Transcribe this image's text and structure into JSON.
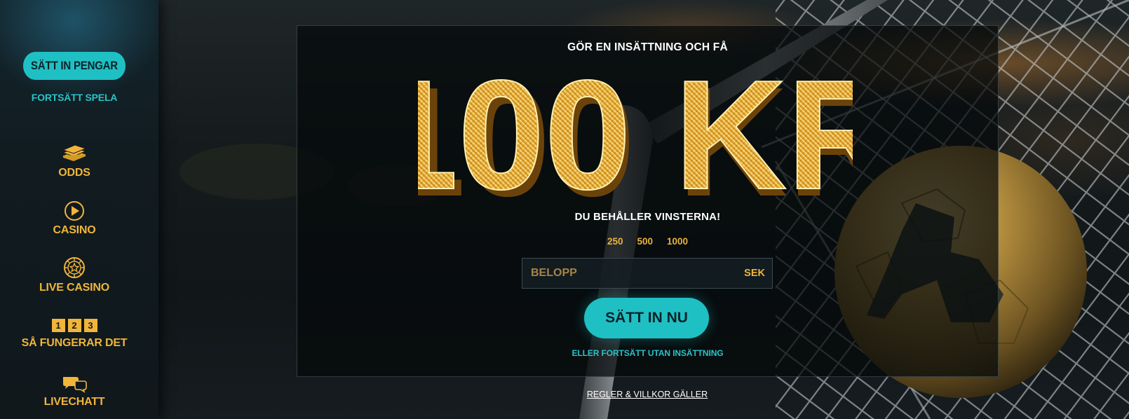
{
  "sidebar": {
    "deposit_button": "SÄTT IN PENGAR",
    "continue_link": "FORTSÄTT SPELA",
    "items": [
      {
        "label": "ODDS",
        "icon": "money-stack-icon"
      },
      {
        "label": "CASINO",
        "icon": "play-circle-icon"
      },
      {
        "label": "LIVE CASINO",
        "icon": "roulette-chip-icon"
      },
      {
        "label": "SÅ FUNGERAR DET",
        "icon": "steps-123-icon",
        "steps": [
          "1",
          "2",
          "3"
        ]
      },
      {
        "label": "LIVECHATT",
        "icon": "chat-bubbles-icon"
      }
    ]
  },
  "promo": {
    "headline": "GÖR EN INSÄTTNING OCH FÅ",
    "amount": "100 KR",
    "subline": "DU BEHÅLLER VINSTERNA!",
    "quick_amounts": [
      "250",
      "500",
      "1000"
    ],
    "input_placeholder": "BELOPP",
    "currency": "SEK",
    "submit_button": "SÄTT IN NU",
    "skip_link": "ELLER FORTSÄTT UTAN INSÄTTNING"
  },
  "footer": {
    "terms_link": "REGLER & VILLKOR GÄLLER"
  },
  "colors": {
    "accent_teal": "#1fc0c4",
    "gold": "#f0b53a",
    "panel_bg": "#04080a"
  }
}
